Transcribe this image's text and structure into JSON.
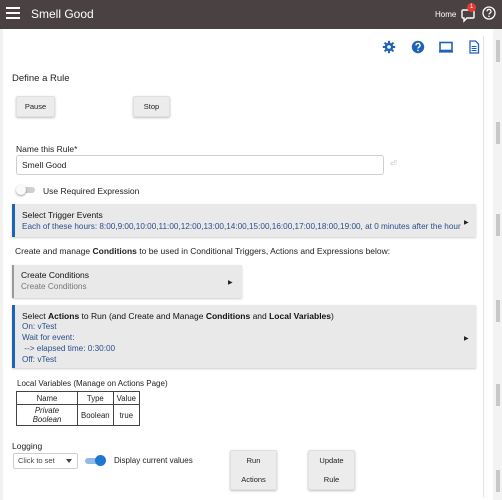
{
  "header": {
    "title": "Smell Good",
    "home_label": "Home",
    "notification_count": "1"
  },
  "toolbar_icons": [
    "gear-icon",
    "help-icon",
    "monitor-icon",
    "document-icon"
  ],
  "page": {
    "heading": "Define a Rule",
    "pause_label": "Pause",
    "stop_label": "Stop",
    "name_label": "Name this Rule*",
    "name_value": "Smell Good",
    "use_required_expression": "Use Required Expression"
  },
  "trigger": {
    "title": "Select Trigger Events",
    "detail": "Each of these hours: 8:00,9:00,10:00,11:00,12:00,13:00,14:00,15:00,16:00,17:00,18:00,19:00, at 0 minutes after the hour"
  },
  "conditions_intro": {
    "prefix": "Create and manage ",
    "bold": "Conditions",
    "suffix": " to be used in Conditional Triggers, Actions and Expressions below:"
  },
  "conditions_panel": {
    "title": "Create Conditions",
    "subtitle": "Create Conditions"
  },
  "actions_panel": {
    "t1": "Select ",
    "t2": "Actions",
    "t3": " to Run (and Create and Manage ",
    "t4": "Conditions",
    "t5": " and ",
    "t6": "Local Variables",
    "t7": ")",
    "lines": [
      "On: vTest",
      "Wait for event:",
      " --> elapsed time: 0:30:00",
      "Off: vTest"
    ]
  },
  "local_variables": {
    "title_bold": "Local Variables",
    "title_rest": " (Manage on Actions Page)",
    "headers": [
      "Name",
      "Type",
      "Value"
    ],
    "rows": [
      [
        "Private Boolean",
        "Boolean",
        "true"
      ]
    ]
  },
  "logging": {
    "label": "Logging",
    "select_value": "Click to set",
    "display_label": "Display current values"
  },
  "buttons": {
    "run_line1": "Run",
    "run_line2": "Actions",
    "update_line1": "Update",
    "update_line2": "Rule"
  },
  "colors": {
    "topbar": "#4a4242",
    "accent": "#1e63b5",
    "link_text": "#2b4e8c",
    "badge": "#e53935"
  }
}
